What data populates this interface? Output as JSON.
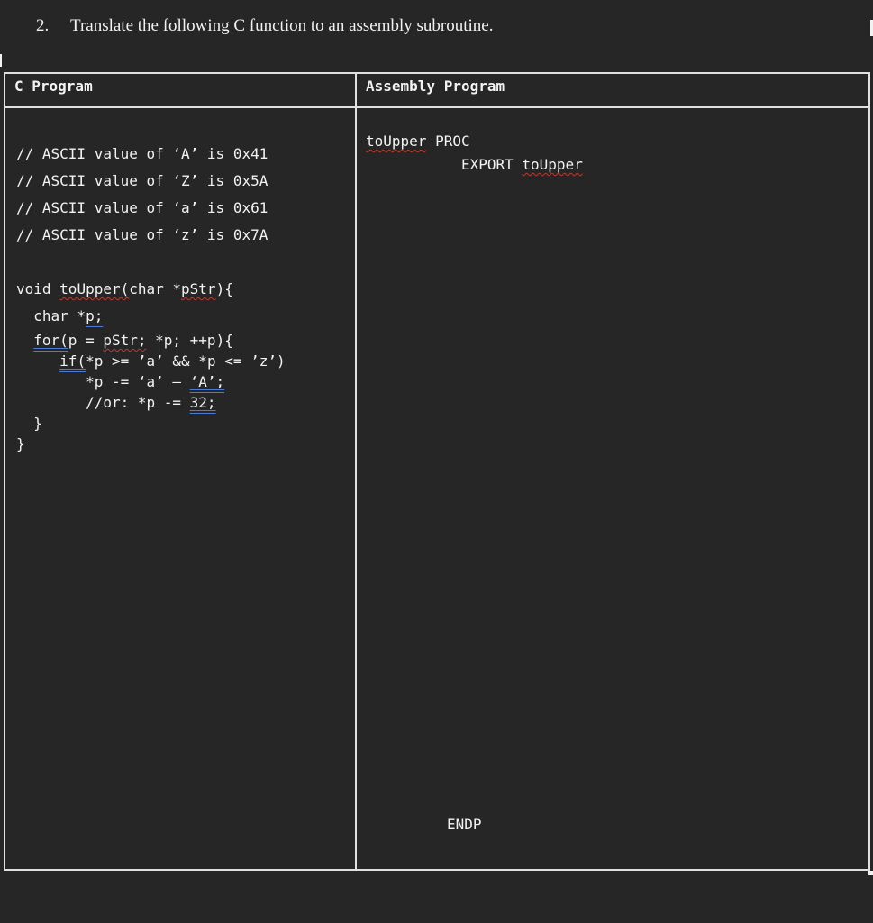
{
  "question": {
    "number": "2.",
    "text": "Translate the following C function to an assembly subroutine."
  },
  "table": {
    "headers": {
      "c": "C Program",
      "asm": "Assembly Program"
    },
    "c_lines": {
      "comment1": "// ASCII value of ‘A’ is 0x41",
      "comment2": "// ASCII value of ‘Z’ is 0x5A",
      "comment3": "// ASCII value of ‘a’ is 0x61",
      "comment4": "// ASCII value of ‘z’ is 0x7A",
      "sig_pre": "void ",
      "sig_fn": "toUpper(",
      "sig_mid": "char *",
      "sig_param": "pStr",
      "sig_post": "){",
      "decl_pre": "  char *",
      "decl_var": "p;",
      "for_kw": "for(",
      "for_mid": "p = ",
      "for_init": "pStr;",
      "for_post": " *p; ++p){",
      "if_kw": "if(",
      "if_post": "*p >= ’a’ && *p <= ’z’)",
      "sub_pre": "*p -= ‘a’ – ",
      "sub_lit": "‘A’;",
      "or_pre": "//or: *p -= ",
      "or_lit": "32;",
      "close_inner": "  }",
      "close_outer": "}"
    },
    "asm_lines": {
      "proc_name": "toUpper",
      "proc_kw": " PROC",
      "export_pre": "           EXPORT ",
      "export_name": "toUpper",
      "endp": "ENDP"
    }
  }
}
